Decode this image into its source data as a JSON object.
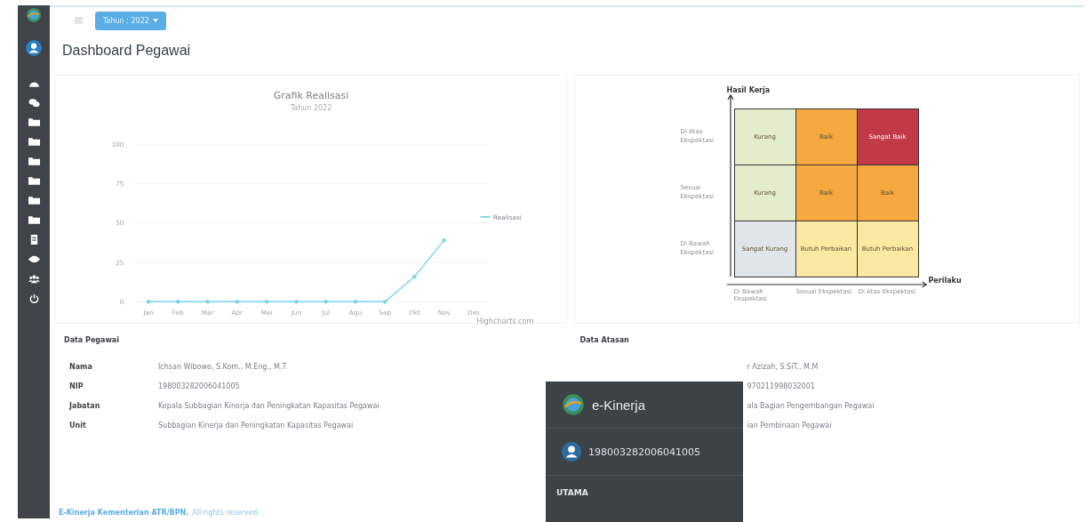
{
  "topbar": {
    "year_button": "Tahun : 2022"
  },
  "page_title": "Dashboard Pegawai",
  "chart": {
    "credit": "Highcharts.com",
    "chart_data": {
      "type": "line",
      "grid": true,
      "title": "Grafik Realisasi",
      "subtitle": "Tahun 2022",
      "categories": [
        "Jan",
        "Feb",
        "Mar",
        "Apr",
        "Mei",
        "Jun",
        "Jul",
        "Agu",
        "Sep",
        "Okt",
        "Nov",
        "Des"
      ],
      "series": [
        {
          "name": "Realisasi",
          "color": "#7cd4e8",
          "values": [
            0,
            0,
            0,
            0,
            0,
            0,
            0,
            0,
            0,
            16,
            39,
            null
          ]
        }
      ],
      "ylim": [
        0,
        100
      ],
      "yticks": [
        0,
        25,
        50,
        75,
        100
      ]
    }
  },
  "matrix": {
    "y_title": "Hasil Kerja",
    "x_title": "Perilaku",
    "y_labels": [
      "Di Atas Ekspektasi",
      "Sesuai Ekspektasi",
      "Di Bawah Ekspektasi"
    ],
    "x_labels": [
      "Di Bawah Ekspektasi",
      "Sesuai Ekspektasi",
      "Di Atas Ekspektasi"
    ],
    "rows": [
      {
        "cells": [
          {
            "label": "Kurang",
            "color": "#e4edcb"
          },
          {
            "label": "Baik",
            "color": "#f5a940"
          },
          {
            "label": "Sangat Baik",
            "color": "#c23a48"
          }
        ]
      },
      {
        "cells": [
          {
            "label": "Kurang",
            "color": "#e4edcb"
          },
          {
            "label": "Baik",
            "color": "#f5a940"
          },
          {
            "label": "Baik",
            "color": "#f5a940"
          }
        ]
      },
      {
        "cells": [
          {
            "label": "Sangat Kurang",
            "color": "#dfe5e9"
          },
          {
            "label": "Butuh Perbaikan",
            "color": "#f9e9a2"
          },
          {
            "label": "Butuh Perbaikan",
            "color": "#f9e9a2"
          }
        ]
      }
    ]
  },
  "data_pegawai": {
    "title": "Data Pegawai",
    "fields": [
      {
        "label": "Nama",
        "value": "Ichsan Wibowo, S.Kom., M.Eng., M.T"
      },
      {
        "label": "NIP",
        "value": "198003282006041005"
      },
      {
        "label": "Jabatan",
        "value": "Kepala Subbagian Kinerja dan Peningkatan Kapasitas Pegawai"
      },
      {
        "label": "Unit",
        "value": "Subbagian Kinerja dan Peningkatan Kapasitas Pegawai"
      }
    ]
  },
  "data_atasan": {
    "title": "Data Atasan",
    "values": [
      "r Azizah, S.SiT., M.M",
      "970211998032001",
      "ala Bagian Pengembangan Pegawai",
      "ian Pembinaan Pegawai"
    ]
  },
  "overlay": {
    "app_name": "e-Kinerja",
    "user_id": "198003282006041005",
    "section": "UTAMA"
  },
  "footer": {
    "brand": "E-Kinerja Kementerian ATR/BPN.",
    "text": "All rights reserved."
  }
}
